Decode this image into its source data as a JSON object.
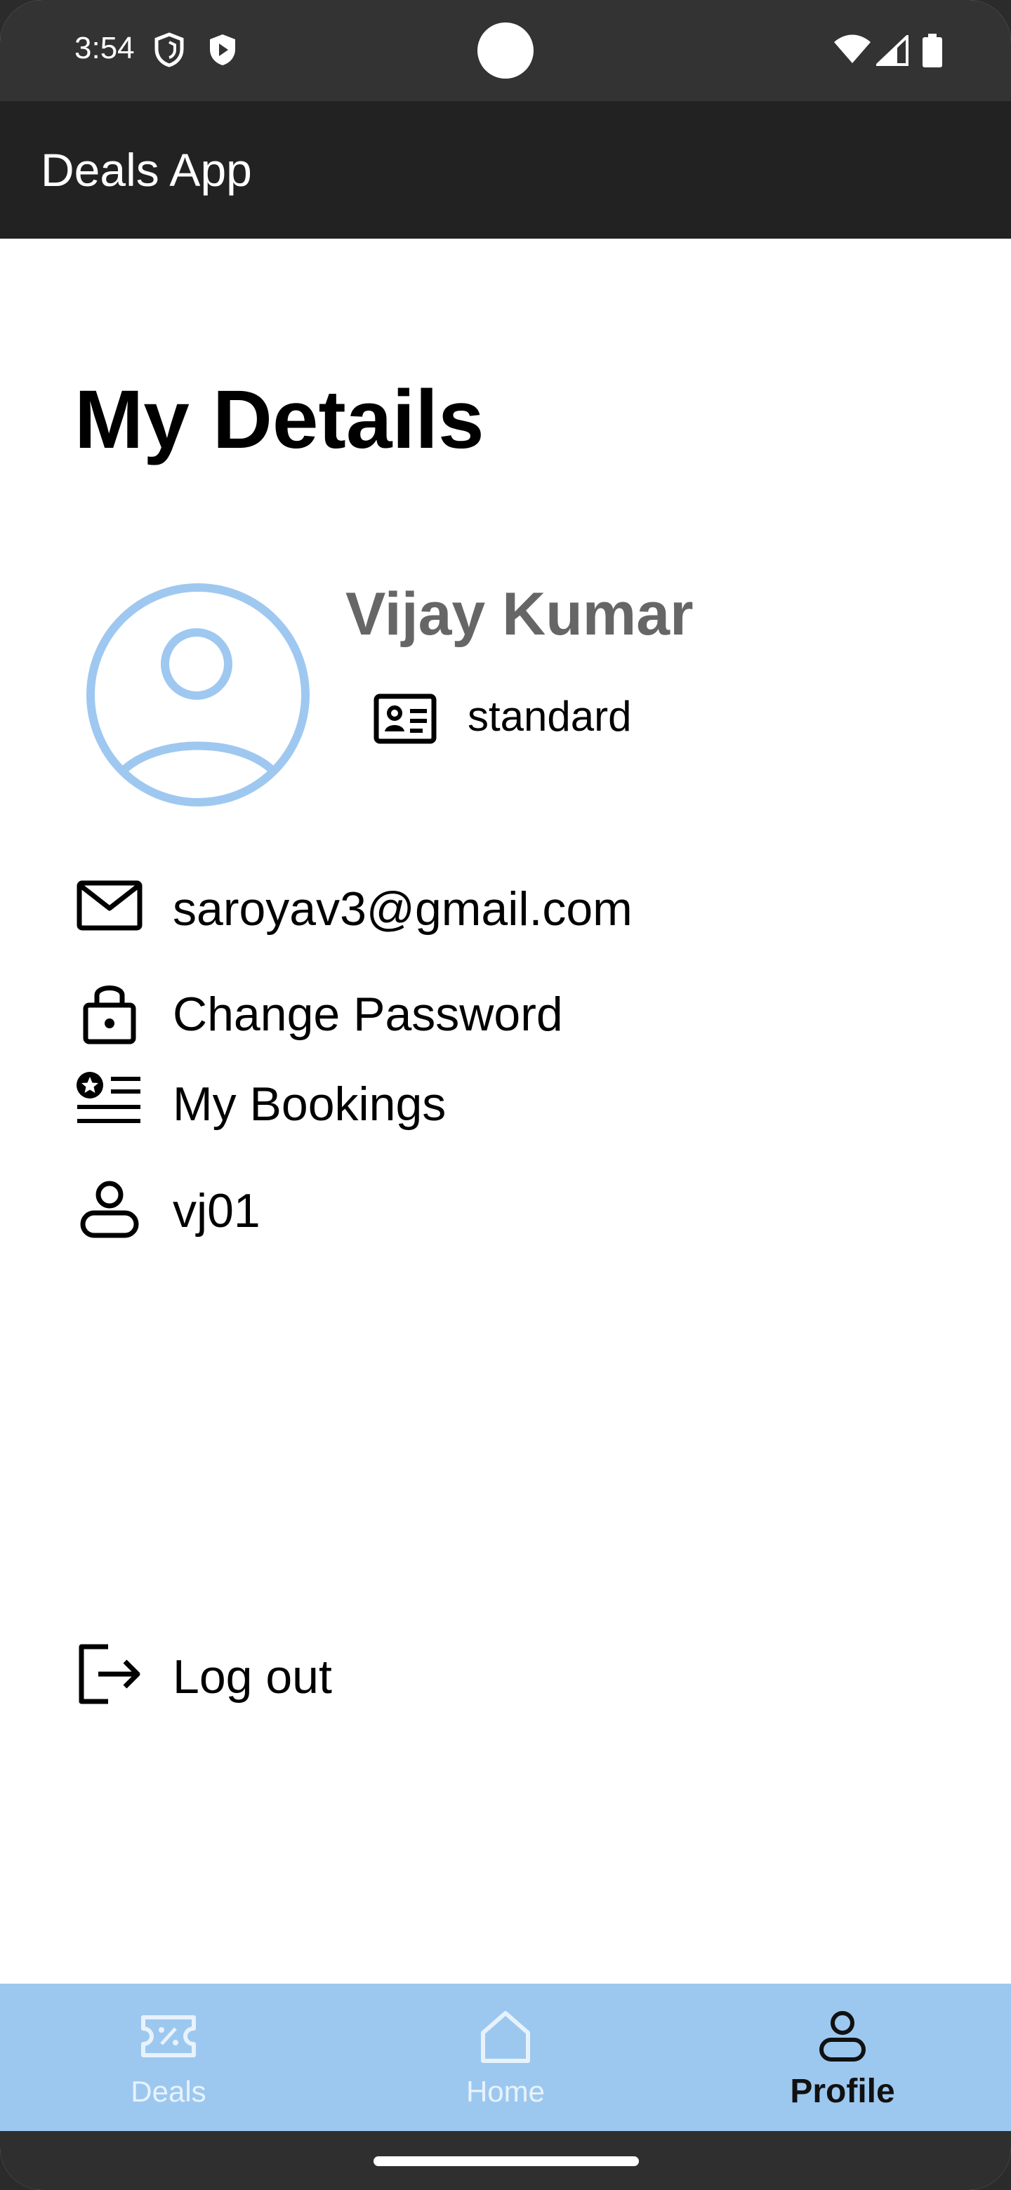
{
  "status_bar": {
    "time": "3:54",
    "left_icons": [
      "vpn-shield-icon",
      "play-protect-icon"
    ],
    "right_icons": [
      "wifi-icon",
      "cellular-signal-icon",
      "battery-icon"
    ]
  },
  "app_bar": {
    "title": "Deals App"
  },
  "page": {
    "title": "My Details"
  },
  "profile": {
    "name": "Vijay Kumar",
    "membership": "standard",
    "avatar_color": "#9ec8f0"
  },
  "details": [
    {
      "icon": "mail-icon",
      "label": "saroyav3@gmail.com"
    },
    {
      "icon": "lock-icon",
      "label": "Change Password"
    },
    {
      "icon": "bookings-list-icon",
      "label": "My Bookings"
    },
    {
      "icon": "user-icon",
      "label": "vj01"
    }
  ],
  "logout": {
    "icon": "logout-icon",
    "label": "Log out"
  },
  "bottom_nav": {
    "background": "#9cc8f0",
    "items": [
      {
        "label": "Deals",
        "icon": "ticket-percent-icon",
        "active": false
      },
      {
        "label": "Home",
        "icon": "home-icon",
        "active": false
      },
      {
        "label": "Profile",
        "icon": "user-icon",
        "active": true
      }
    ]
  }
}
